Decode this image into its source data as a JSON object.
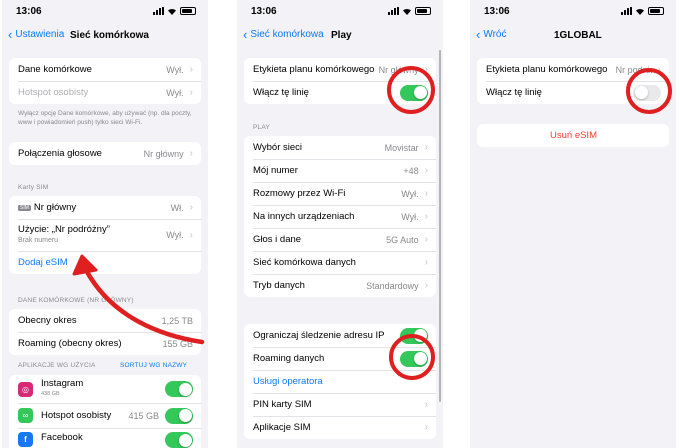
{
  "colors": {
    "accent": "#0a7aff",
    "toggle_on": "#34c759",
    "annotation": "#e02020",
    "destructive": "#ff3b30"
  },
  "screen1": {
    "time": "13:06",
    "back": "Ustawienia",
    "title": "Sieć komórkowa",
    "group1": [
      {
        "label": "Dane komórkowe",
        "value": "Wył."
      },
      {
        "label": "Hotspot osobisty",
        "value": "Wył."
      }
    ],
    "note": "Wyłącz opcję Dane komórkowe, aby używać (np. dla poczty, www i powiadomień push) tylko sieci Wi-Fi.",
    "group2": [
      {
        "label": "Połączenia głosowe",
        "value": "Nr główny"
      }
    ],
    "sim_header": "Karty SIM",
    "sim_rows": [
      {
        "tag": "SIM",
        "label": "Nr główny",
        "value": "Wł."
      },
      {
        "label": "Użycie: „Nr podróżny”",
        "sublabel": "Brak numeru",
        "value": "Wył."
      }
    ],
    "add_esim": "Dodaj eSIM",
    "data_header": "DANE KOMÓRKOWE (NR GŁÓWNY)",
    "usage": [
      {
        "label": "Obecny okres",
        "value": "1,25 TB"
      },
      {
        "label": "Roaming (obecny okres)",
        "value": "155 GB"
      }
    ],
    "apps_header": "APLIKACJE WG UŻYCIA",
    "sort_link": "SORTUJ WG NAZWY",
    "apps": [
      {
        "name": "Instagram",
        "size": "438 GB",
        "icon": "instagram-icon",
        "color": "#d62976"
      },
      {
        "name": "Hotspot osobisty",
        "size": "415 GB",
        "icon": "hotspot-icon",
        "color": "#34c759"
      },
      {
        "name": "Facebook",
        "size": "",
        "icon": "facebook-icon",
        "color": "#1877f2"
      }
    ]
  },
  "screen2": {
    "time": "13:06",
    "back": "Sieć komórkowa",
    "title": "Play",
    "group1": [
      {
        "label": "Etykieta planu komórkowego",
        "value": "Nr główny"
      },
      {
        "label": "Włącz tę linię"
      }
    ],
    "play_header": "PLAY",
    "group2": [
      {
        "label": "Wybór sieci",
        "value": "Movistar"
      },
      {
        "label": "Mój numer",
        "value": "+48"
      },
      {
        "label": "Rozmowy przez Wi-Fi",
        "value": "Wył."
      },
      {
        "label": "Na innych urządzeniach",
        "value": "Wył."
      },
      {
        "label": "Głos i dane",
        "value": "5G Auto"
      },
      {
        "label": "Sieć komórkowa danych",
        "value": ""
      },
      {
        "label": "Tryb danych",
        "value": "Standardowy"
      }
    ],
    "group3": [
      {
        "label": "Ograniczaj śledzenie adresu IP"
      },
      {
        "label": "Roaming danych"
      },
      {
        "label": "Usługi operatora"
      },
      {
        "label": "PIN karty SIM"
      },
      {
        "label": "Aplikacje SIM"
      }
    ]
  },
  "screen3": {
    "time": "13:06",
    "back": "Wróć",
    "title": "1GLOBAL",
    "group1": [
      {
        "label": "Etykieta planu komórkowego",
        "value": "Nr podróżny"
      },
      {
        "label": "Włącz tę linię"
      }
    ],
    "delete": "Usuń eSIM"
  }
}
